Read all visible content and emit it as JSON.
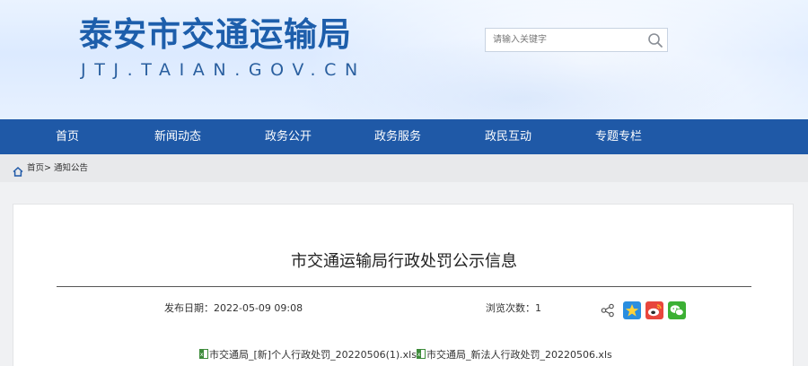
{
  "header": {
    "site_title": "泰安市交通运输局",
    "site_domain": "JTJ.TAIAN.GOV.CN",
    "search_placeholder": "请输入关键字"
  },
  "nav": {
    "items": [
      "首页",
      "新闻动态",
      "政务公开",
      "政务服务",
      "政民互动",
      "专题专栏"
    ]
  },
  "breadcrumb": {
    "home": "首页",
    "separator": ">",
    "current": "通知公告"
  },
  "article": {
    "title": "市交通运输局行政处罚公示信息",
    "publish_label": "发布日期：",
    "publish_date": "2022-05-09 09:08",
    "views_label": "浏览次数：",
    "views_count": "1",
    "attachments": [
      "市交通局_[新]个人行政处罚_20220506(1).xls",
      "市交通局_新法人行政处罚_20220506.xls"
    ]
  },
  "share": {
    "icons": [
      "share-icon",
      "qzone-icon",
      "weibo-icon",
      "wechat-icon"
    ]
  },
  "colors": {
    "brand_blue": "#1f59a7",
    "title_blue": "#1d5eab",
    "breadcrumb_bg": "#e8e9eb",
    "page_bg": "#f0f1f3"
  }
}
